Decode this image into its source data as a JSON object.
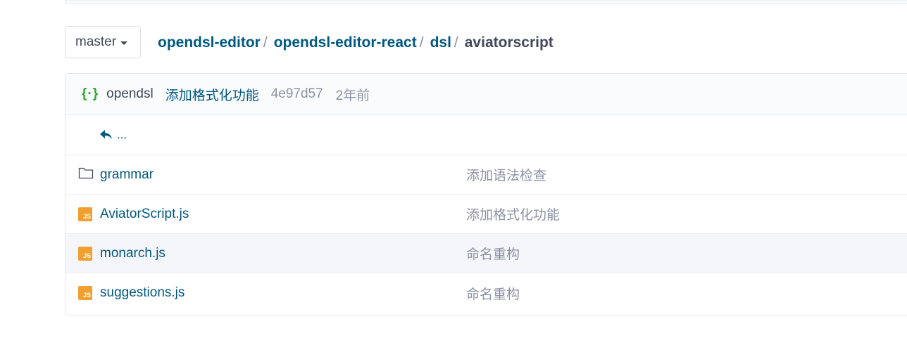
{
  "branch": {
    "label": "master"
  },
  "breadcrumb": {
    "items": [
      "opendsl-editor",
      "opendsl-editor-react",
      "dsl"
    ],
    "current": "aviatorscript",
    "separator": "/"
  },
  "commit": {
    "logo_text": "{·}",
    "author": "opendsl",
    "message": "添加格式化功能",
    "sha": "4e97d57",
    "time": "2年前"
  },
  "parent_link": {
    "label": "..."
  },
  "files": [
    {
      "icon": "folder-icon",
      "name": "grammar",
      "commit_message": "添加语法检查"
    },
    {
      "icon": "js-file-icon",
      "icon_text": "JS",
      "name": "AviatorScript.js",
      "commit_message": "添加格式化功能"
    },
    {
      "icon": "js-file-icon",
      "icon_text": "JS",
      "name": "monarch.js",
      "commit_message": "命名重构"
    },
    {
      "icon": "js-file-icon",
      "icon_text": "JS",
      "name": "suggestions.js",
      "commit_message": "命名重构"
    }
  ],
  "colors": {
    "link": "#005980",
    "muted": "#8c92a4",
    "js_icon": "#f0a030",
    "commit_logo": "#28a828",
    "hover_row": "#f5f6f9"
  }
}
